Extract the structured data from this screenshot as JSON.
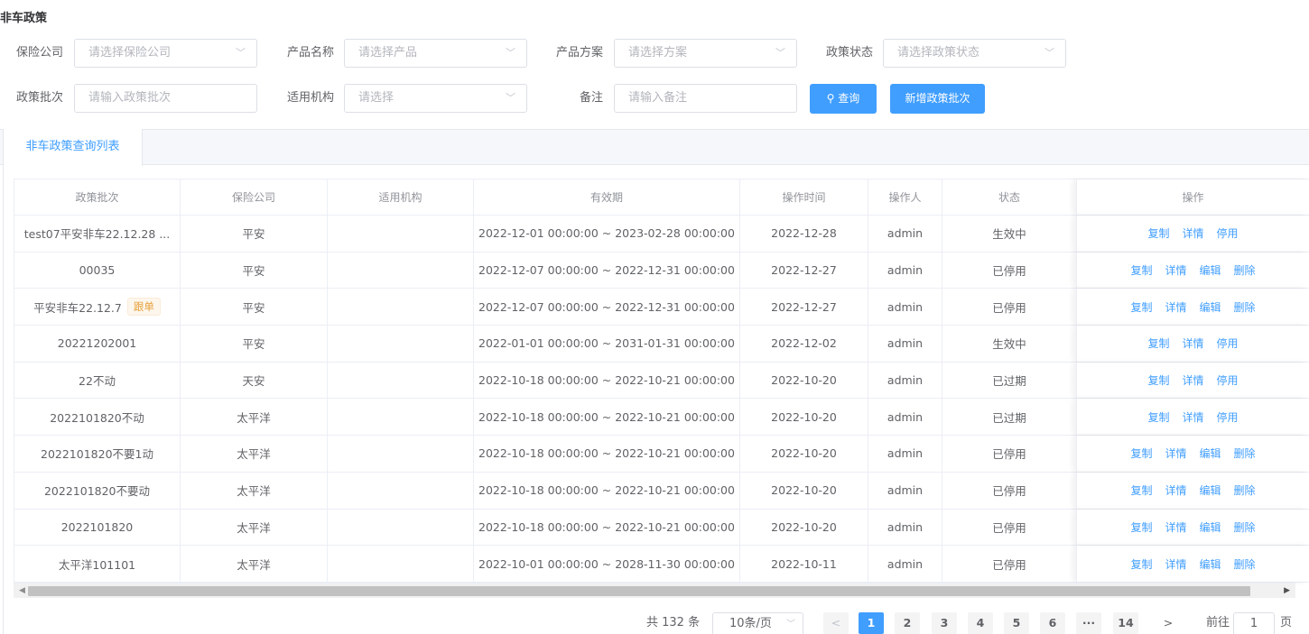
{
  "page": {
    "title": "非车政策"
  },
  "filters": {
    "insurer": {
      "label": "保险公司",
      "placeholder": "请选择保险公司"
    },
    "product": {
      "label": "产品名称",
      "placeholder": "请选择产品"
    },
    "plan": {
      "label": "产品方案",
      "placeholder": "请选择方案"
    },
    "status": {
      "label": "政策状态",
      "placeholder": "请选择政策状态"
    },
    "batch": {
      "label": "政策批次",
      "placeholder": "请输入政策批次"
    },
    "org": {
      "label": "适用机构",
      "placeholder": "请选择"
    },
    "remark": {
      "label": "备注",
      "placeholder": "请输入备注"
    }
  },
  "buttons": {
    "search": "查询",
    "add": "新增政策批次"
  },
  "tabs": [
    {
      "label": "非车政策查询列表"
    }
  ],
  "table": {
    "headers": [
      "政策批次",
      "保险公司",
      "适用机构",
      "有效期",
      "操作时间",
      "操作人",
      "状态",
      "操作"
    ],
    "rows": [
      {
        "batch": "test07平安非车22.12.28 ...",
        "tag": "",
        "insurer": "平安",
        "org": "",
        "period": "2022-12-01 00:00:00 ~ 2023-02-28 00:00:00",
        "time": "2022-12-28",
        "operator": "admin",
        "status": "生效中",
        "actions": [
          "复制",
          "详情",
          "停用"
        ]
      },
      {
        "batch": "00035",
        "tag": "",
        "insurer": "平安",
        "org": "",
        "period": "2022-12-07 00:00:00 ~ 2022-12-31 00:00:00",
        "time": "2022-12-27",
        "operator": "admin",
        "status": "已停用",
        "actions": [
          "复制",
          "详情",
          "编辑",
          "删除"
        ]
      },
      {
        "batch": "平安非车22.12.7",
        "tag": "跟单",
        "insurer": "平安",
        "org": "",
        "period": "2022-12-07 00:00:00 ~ 2022-12-31 00:00:00",
        "time": "2022-12-27",
        "operator": "admin",
        "status": "已停用",
        "actions": [
          "复制",
          "详情",
          "编辑",
          "删除"
        ]
      },
      {
        "batch": "20221202001",
        "tag": "",
        "insurer": "平安",
        "org": "",
        "period": "2022-01-01 00:00:00 ~ 2031-01-31 00:00:00",
        "time": "2022-12-02",
        "operator": "admin",
        "status": "生效中",
        "actions": [
          "复制",
          "详情",
          "停用"
        ]
      },
      {
        "batch": "22不动",
        "tag": "",
        "insurer": "天安",
        "org": "",
        "period": "2022-10-18 00:00:00 ~ 2022-10-21 00:00:00",
        "time": "2022-10-20",
        "operator": "admin",
        "status": "已过期",
        "actions": [
          "复制",
          "详情",
          "停用"
        ]
      },
      {
        "batch": "2022101820不动",
        "tag": "",
        "insurer": "太平洋",
        "org": "",
        "period": "2022-10-18 00:00:00 ~ 2022-10-21 00:00:00",
        "time": "2022-10-20",
        "operator": "admin",
        "status": "已过期",
        "actions": [
          "复制",
          "详情",
          "停用"
        ]
      },
      {
        "batch": "2022101820不要1动",
        "tag": "",
        "insurer": "太平洋",
        "org": "",
        "period": "2022-10-18 00:00:00 ~ 2022-10-21 00:00:00",
        "time": "2022-10-20",
        "operator": "admin",
        "status": "已停用",
        "actions": [
          "复制",
          "详情",
          "编辑",
          "删除"
        ]
      },
      {
        "batch": "2022101820不要动",
        "tag": "",
        "insurer": "太平洋",
        "org": "",
        "period": "2022-10-18 00:00:00 ~ 2022-10-21 00:00:00",
        "time": "2022-10-20",
        "operator": "admin",
        "status": "已停用",
        "actions": [
          "复制",
          "详情",
          "编辑",
          "删除"
        ]
      },
      {
        "batch": "2022101820",
        "tag": "",
        "insurer": "太平洋",
        "org": "",
        "period": "2022-10-18 00:00:00 ~ 2022-10-21 00:00:00",
        "time": "2022-10-20",
        "operator": "admin",
        "status": "已停用",
        "actions": [
          "复制",
          "详情",
          "编辑",
          "删除"
        ]
      },
      {
        "batch": "太平洋101101",
        "tag": "",
        "insurer": "太平洋",
        "org": "",
        "period": "2022-10-01 00:00:00 ~ 2028-11-30 00:00:00",
        "time": "2022-10-11",
        "operator": "admin",
        "status": "已停用",
        "actions": [
          "复制",
          "详情",
          "编辑",
          "删除"
        ]
      }
    ]
  },
  "pagination": {
    "total": "共 132 条",
    "page_size": "10条/页",
    "prev": "<",
    "pages": [
      "1",
      "2",
      "3",
      "4",
      "5",
      "6",
      "···",
      "14"
    ],
    "current": "1",
    "next": ">",
    "goto_label": "前往",
    "goto_value": "1",
    "page_label": "页"
  },
  "colors": {
    "primary": "#409eff",
    "tag_warning": "#e6a23c",
    "border": "#ebeef5"
  }
}
